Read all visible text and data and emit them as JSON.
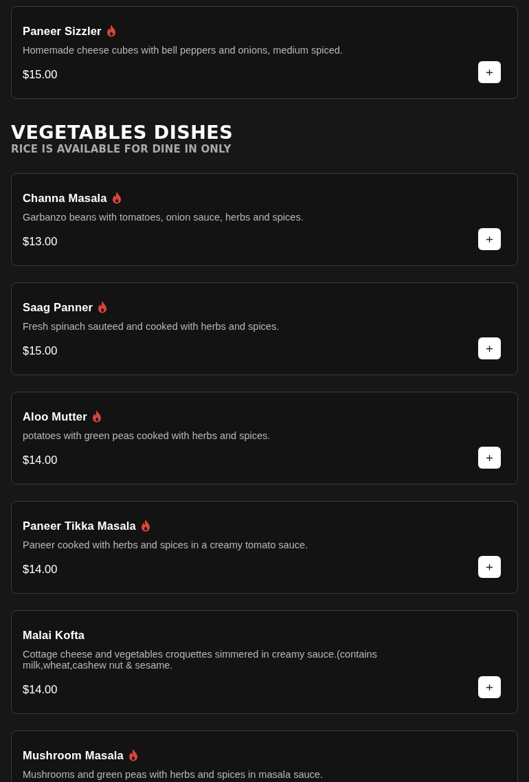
{
  "sections": [
    {
      "items": [
        {
          "name": "Paneer Sizzler",
          "spicy": true,
          "description": "Homemade cheese cubes with bell peppers and onions, medium spiced.",
          "price": "$15.00"
        }
      ]
    },
    {
      "title": "VEGETABLES DISHES",
      "subtitle": "RICE IS AVAILABLE FOR DINE IN ONLY",
      "items": [
        {
          "name": "Channa Masala",
          "spicy": true,
          "description": "Garbanzo beans with tomatoes, onion sauce, herbs and spices.",
          "price": "$13.00"
        },
        {
          "name": "Saag Panner",
          "spicy": true,
          "description": "Fresh spinach sauteed and cooked with herbs and spices.",
          "price": "$15.00"
        },
        {
          "name": "Aloo Mutter",
          "spicy": true,
          "description": "potatoes with green peas cooked with herbs and spices.",
          "price": "$14.00"
        },
        {
          "name": "Paneer Tikka Masala",
          "spicy": true,
          "description": "Paneer cooked with herbs and spices in a creamy tomato sauce.",
          "price": "$14.00"
        },
        {
          "name": "Malai Kofta",
          "spicy": false,
          "description": "Cottage cheese and vegetables croquettes simmered in creamy sauce.(contains milk,wheat,cashew nut & sesame.",
          "price": "$14.00"
        },
        {
          "name": "Mushroom Masala",
          "spicy": true,
          "description": "Mushrooms and green peas with herbs and spices in masala sauce."
        }
      ]
    }
  ]
}
